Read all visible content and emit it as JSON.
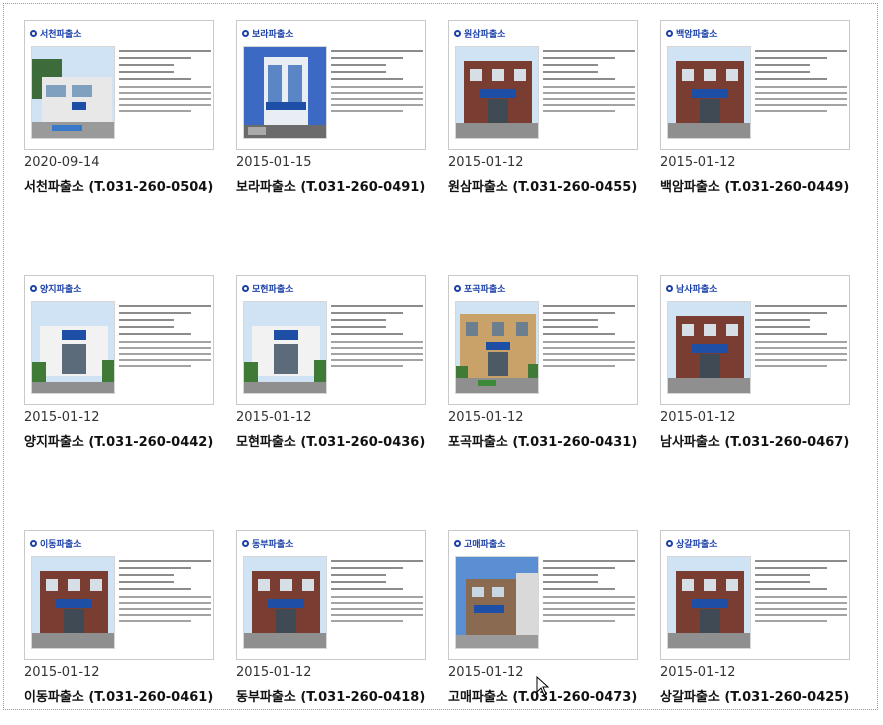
{
  "cards": [
    {
      "title": "서천파출소",
      "date": "2020-09-14",
      "name": "서천파출소 (T.031-260-0504)",
      "photo": "modern"
    },
    {
      "title": "보라파출소",
      "date": "2015-01-15",
      "name": "보라파출소 (T.031-260-0491)",
      "photo": "tower"
    },
    {
      "title": "원삼파출소",
      "date": "2015-01-12",
      "name": "원삼파출소 (T.031-260-0455)",
      "photo": "brick"
    },
    {
      "title": "백암파출소",
      "date": "2015-01-12",
      "name": "백암파출소 (T.031-260-0449)",
      "photo": "brick"
    },
    {
      "title": "양지파출소",
      "date": "2015-01-12",
      "name": "양지파출소 (T.031-260-0442)",
      "photo": "white"
    },
    {
      "title": "모현파출소",
      "date": "2015-01-12",
      "name": "모현파출소 (T.031-260-0436)",
      "photo": "white"
    },
    {
      "title": "포곡파출소",
      "date": "2015-01-12",
      "name": "포곡파출소 (T.031-260-0431)",
      "photo": "tan"
    },
    {
      "title": "남사파출소",
      "date": "2015-01-12",
      "name": "남사파출소 (T.031-260-0467)",
      "photo": "brick"
    },
    {
      "title": "이동파출소",
      "date": "2015-01-12",
      "name": "이동파출소 (T.031-260-0461)",
      "photo": "brick"
    },
    {
      "title": "동부파출소",
      "date": "2015-01-12",
      "name": "동부파출소 (T.031-260-0418)",
      "photo": "brick"
    },
    {
      "title": "고매파출소",
      "date": "2015-01-12",
      "name": "고매파출소 (T.031-260-0473)",
      "photo": "sky"
    },
    {
      "title": "상갈파출소",
      "date": "2015-01-12",
      "name": "상갈파출소 (T.031-260-0425)",
      "photo": "brick"
    }
  ],
  "colors": {
    "title_blue": "#1a3fa8",
    "frame_border": "#9a9a9a",
    "thumb_border": "#c9c9c9"
  }
}
